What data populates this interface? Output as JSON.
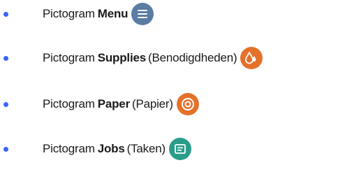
{
  "items": [
    {
      "prefix": "Pictogram",
      "name": "Menu",
      "translation": "",
      "icon": "hamburger-menu-icon",
      "icon_color": "#5b7ca3"
    },
    {
      "prefix": "Pictogram",
      "name": "Supplies",
      "translation": "(Benodigdheden)",
      "icon": "ink-drops-icon",
      "icon_color": "#e4712a"
    },
    {
      "prefix": "Pictogram",
      "name": "Paper",
      "translation": "(Papier)",
      "icon": "paper-roll-icon",
      "icon_color": "#e4712a"
    },
    {
      "prefix": "Pictogram",
      "name": "Jobs",
      "translation": "(Taken)",
      "icon": "jobs-document-icon",
      "icon_color": "#2a9c8a"
    }
  ],
  "bullet_color": "#3b63f7"
}
